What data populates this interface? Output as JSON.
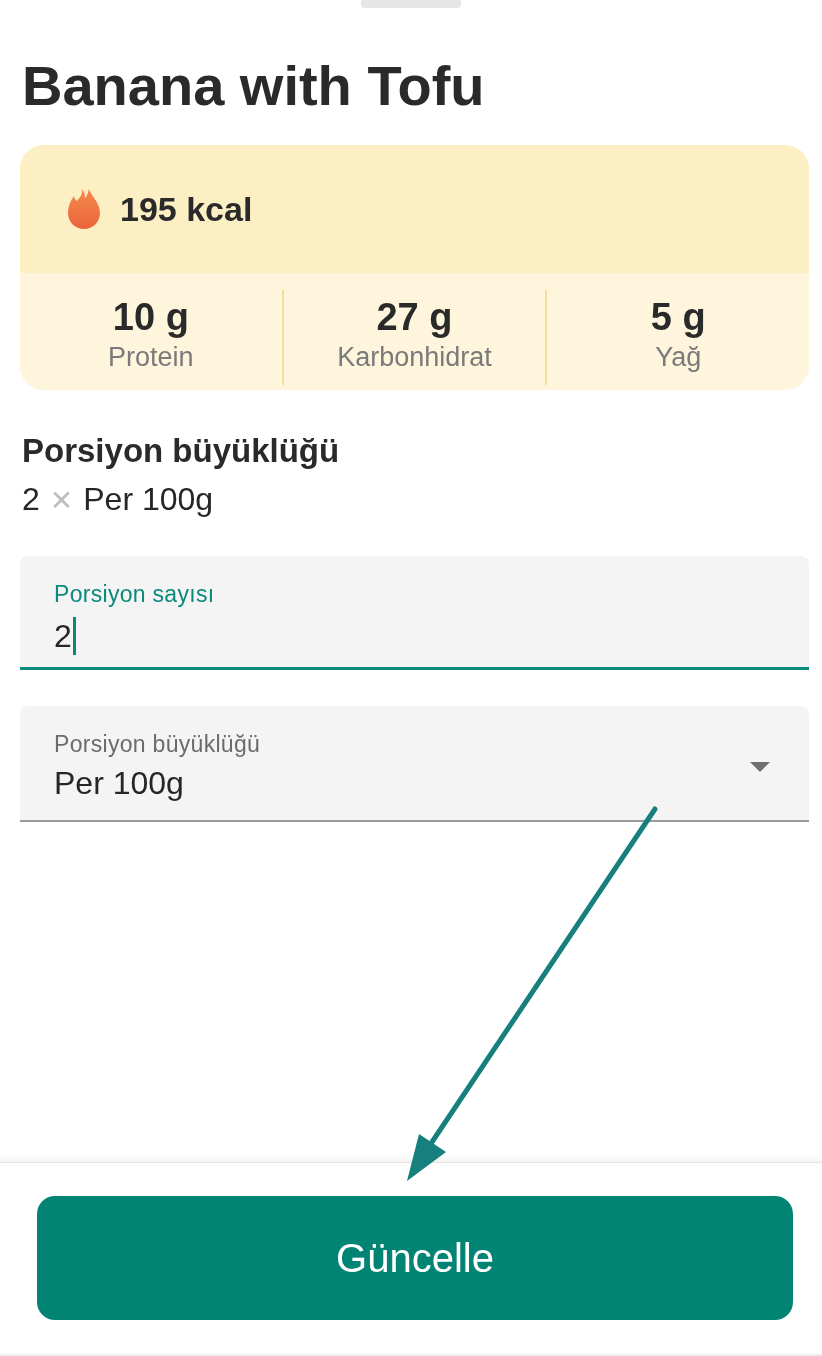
{
  "sheet": {
    "title": "Banana with Tofu"
  },
  "nutrition": {
    "calories": "195 kcal",
    "macros": [
      {
        "value": "10 g",
        "label": "Protein"
      },
      {
        "value": "27 g",
        "label": "Karbonhidrat"
      },
      {
        "value": "5 g",
        "label": "Yağ"
      }
    ]
  },
  "serving": {
    "heading": "Porsiyon büyüklüğü",
    "count": "2",
    "times_sign": "✕",
    "size": "Per 100g"
  },
  "fields": [
    {
      "kind": "text",
      "label": "Porsiyon sayısı",
      "value": "2",
      "focused": true
    },
    {
      "kind": "select",
      "label": "Porsiyon büyüklüğü",
      "value": "Per 100g",
      "focused": false
    }
  ],
  "button": {
    "label": "Güncelle"
  }
}
